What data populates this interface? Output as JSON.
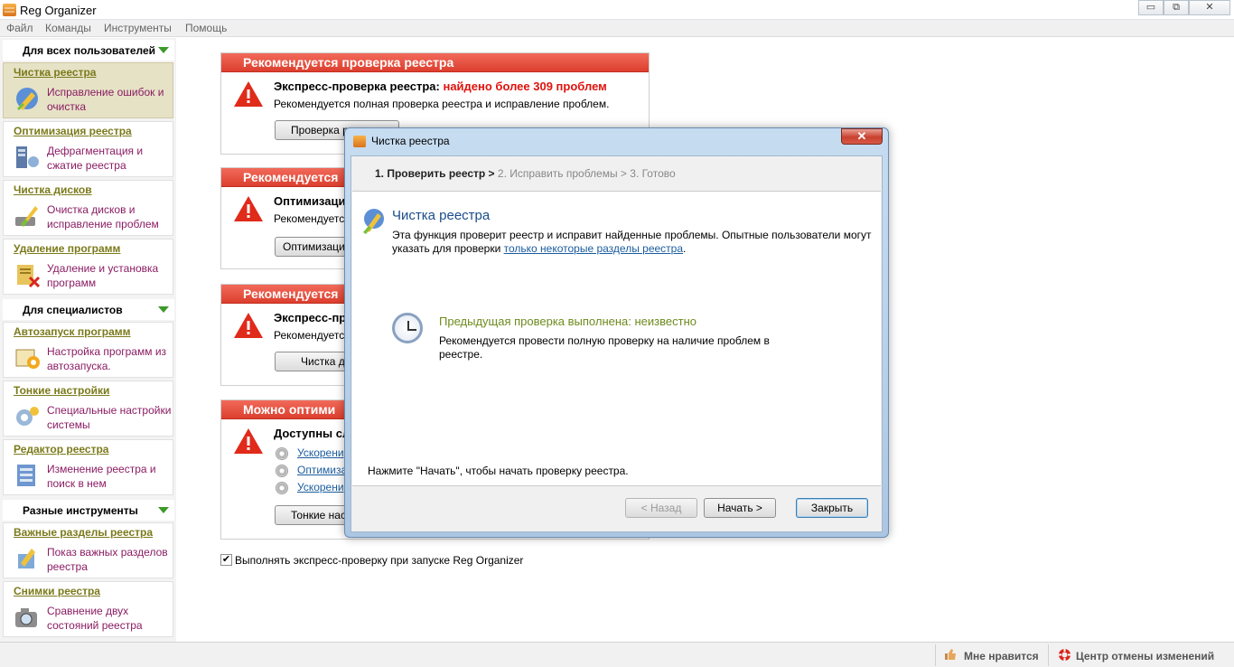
{
  "window": {
    "title": "Reg Organizer",
    "min": "▭",
    "max": "⧉",
    "close": "✕"
  },
  "menu": [
    "Файл",
    "Команды",
    "Инструменты",
    "Помощь"
  ],
  "sidebar": {
    "groups": [
      "Для всех пользователей",
      "Для специалистов",
      "Разные инструменты"
    ],
    "items": [
      {
        "title": "Чистка реестра",
        "desc": "Исправление ошибок и очистка",
        "icon": "broom-icon"
      },
      {
        "title": "Оптимизация реестра",
        "desc": "Дефрагментация и сжатие реестра",
        "icon": "optimize-icon"
      },
      {
        "title": "Чистка дисков",
        "desc": "Очистка дисков и исправление проблем",
        "icon": "disk-broom-icon"
      },
      {
        "title": "Удаление программ",
        "desc": "Удаление и установка программ",
        "icon": "uninstall-icon"
      },
      {
        "title": "Автозапуск программ",
        "desc": "Настройка программ из автозапуска.",
        "icon": "autostart-icon"
      },
      {
        "title": "Тонкие настройки",
        "desc": "Специальные настройки системы",
        "icon": "tweaks-icon"
      },
      {
        "title": "Редактор реестра",
        "desc": "Изменение реестра и поиск в нем",
        "icon": "regedit-icon"
      },
      {
        "title": "Важные разделы реестра",
        "desc": "Показ важных разделов реестра",
        "icon": "important-keys-icon"
      },
      {
        "title": "Снимки реестра",
        "desc": "Сравнение двух состояний реестра",
        "icon": "snapshot-icon"
      }
    ]
  },
  "cards": [
    {
      "header": "Рекомендуется проверка реестра",
      "line1": "Экспресс-проверка реестра: ",
      "line1_red": "найдено более 309 проблем",
      "line2": "Рекомендуется полная проверка реестра и исправление проблем.",
      "button": "Проверка реестра"
    },
    {
      "header": "Рекомендуется",
      "line1": "Оптимизаци",
      "line2": "Рекомендуетс",
      "button": "Оптимизаци"
    },
    {
      "header": "Рекомендуется",
      "line1": "Экспресс-пр",
      "line2": "Рекомендуетс",
      "button": "Чистка д"
    },
    {
      "header": "Можно оптими",
      "line1": "Доступны сл",
      "options": [
        "Ускорени",
        "Оптимиза",
        "Ускорени"
      ],
      "button": "Тонкие нас"
    }
  ],
  "express_check_label": "Выполнять экспресс-проверку при запуске Reg Organizer",
  "express_check_checked": "✔",
  "status": {
    "like": "Мне нравится",
    "undo": "Центр отмены изменений"
  },
  "dialog": {
    "title": "Чистка реестра",
    "close": "✕",
    "step_current": "1. Проверить реестр > ",
    "step_rest": "2. Исправить проблемы > 3. Готово",
    "heading": "Чистка реестра",
    "desc": "Эта функция проверит реестр и исправит найденные проблемы. Опытные пользователи могут указать для проверки ",
    "desc_link": "только некоторые разделы реестра",
    "desc_end": ".",
    "prev_title": "Предыдущая проверка выполнена: неизвестно",
    "prev_desc": "Рекомендуется провести полную проверку на наличие проблем в реестре.",
    "press": "Нажмите \"Начать\", чтобы начать проверку реестра.",
    "back": "< Назад",
    "start": "Начать >",
    "close_btn": "Закрыть"
  }
}
